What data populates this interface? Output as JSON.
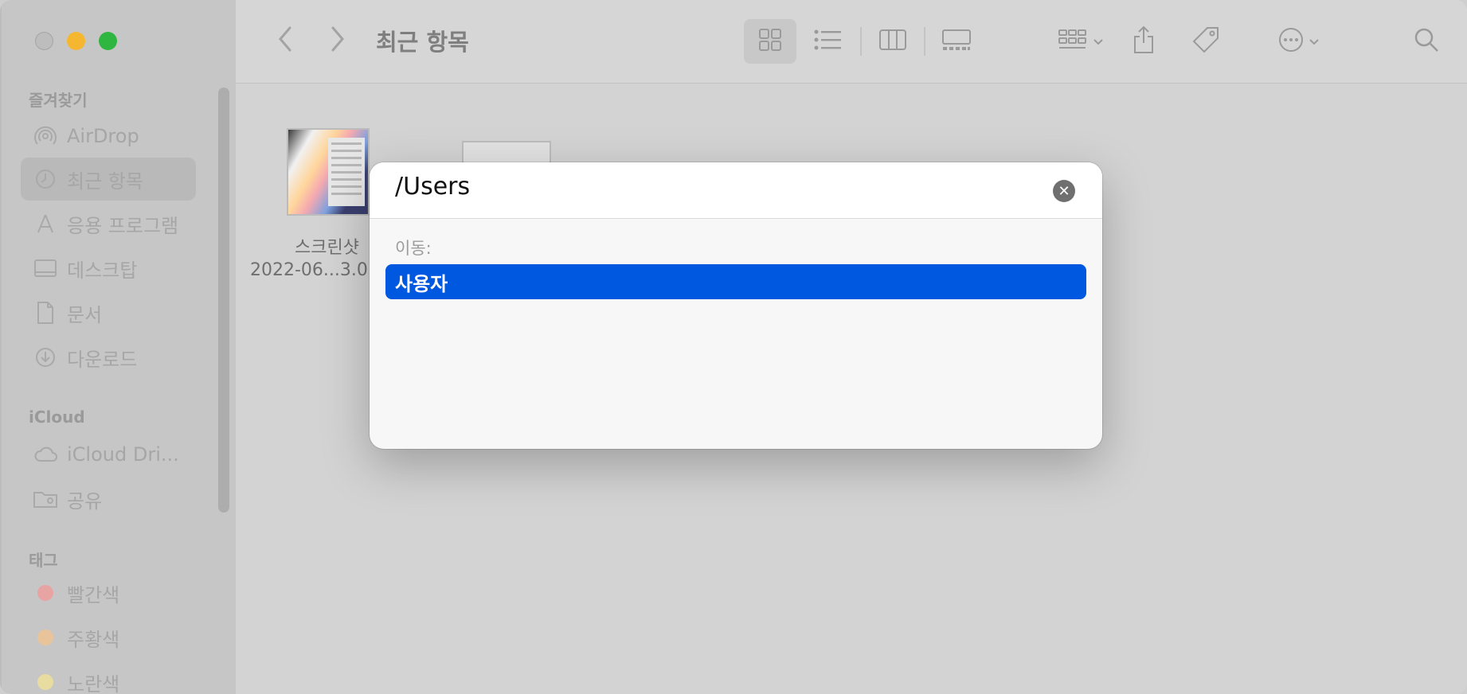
{
  "window": {
    "title": "최근 항목"
  },
  "sidebar": {
    "favorites_header": "즐겨찾기",
    "favorites": [
      {
        "label": "AirDrop",
        "icon": "airdrop-icon"
      },
      {
        "label": "최근 항목",
        "icon": "clock-icon",
        "active": true
      },
      {
        "label": "응용 프로그램",
        "icon": "applications-icon"
      },
      {
        "label": "데스크탑",
        "icon": "desktop-icon"
      },
      {
        "label": "문서",
        "icon": "document-icon"
      },
      {
        "label": "다운로드",
        "icon": "download-icon"
      }
    ],
    "icloud_header": "iCloud",
    "icloud": [
      {
        "label": "iCloud Dri...",
        "icon": "cloud-icon"
      },
      {
        "label": "공유",
        "icon": "shared-folder-icon"
      }
    ],
    "tags_header": "태그",
    "tags": [
      {
        "label": "빨간색",
        "color": "#e8a3a3"
      },
      {
        "label": "주황색",
        "color": "#e9c49a"
      },
      {
        "label": "노란색",
        "color": "#e8dca0"
      }
    ]
  },
  "content": {
    "files": [
      {
        "name": "스크린샷",
        "date": "2022-06...3.0"
      }
    ]
  },
  "dialog": {
    "input_value": "/Users",
    "section_label": "이동:",
    "results": [
      {
        "label": "사용자",
        "selected": true
      }
    ]
  },
  "colors": {
    "selection": "#0058e0",
    "traffic_min": "#f5b730",
    "traffic_max": "#2fb640"
  }
}
